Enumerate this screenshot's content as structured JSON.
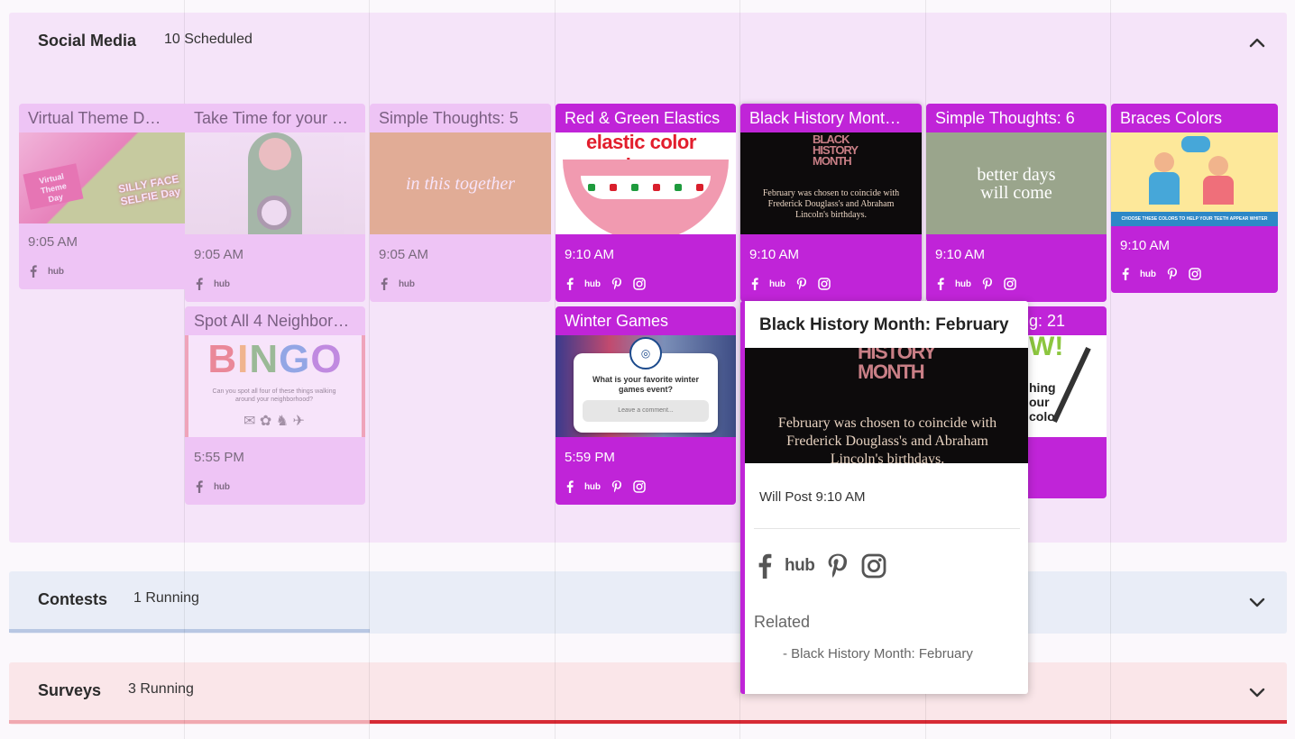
{
  "sections": {
    "social": {
      "title": "Social Media",
      "count": "10 Scheduled"
    },
    "contests": {
      "title": "Contests",
      "count": "1 Running"
    },
    "surveys": {
      "title": "Surveys",
      "count": "3 Running"
    }
  },
  "cards": [
    {
      "title": "Virtual Theme D…",
      "time": "9:05 AM",
      "image_text": "Virtual Theme Day · SILLY FACE SELFIE Day",
      "networks": [
        "facebook",
        "hub"
      ]
    },
    {
      "title": "Take Time for your …",
      "time": "9:05 AM",
      "image_text": "",
      "networks": [
        "facebook",
        "hub"
      ]
    },
    {
      "title": "Simple Thoughts: 5",
      "time": "9:05 AM",
      "image_text": "in this together",
      "networks": [
        "facebook",
        "hub"
      ]
    },
    {
      "title": "Red & Green Elastics",
      "time": "9:10 AM",
      "image_text": "elastic color combo:",
      "networks": [
        "facebook",
        "hub",
        "pinterest",
        "instagram"
      ]
    },
    {
      "title": "Black History Mont…",
      "time": "9:10 AM",
      "image_text": "BLACK HISTORY MONTH · February was chosen to coincide with Frederick Douglass's and Abraham Lincoln's birthdays.",
      "networks": [
        "facebook",
        "hub",
        "pinterest",
        "instagram"
      ]
    },
    {
      "title": "Simple Thoughts: 6",
      "time": "9:10 AM",
      "image_text": "better days will come",
      "networks": [
        "facebook",
        "hub",
        "pinterest",
        "instagram"
      ]
    },
    {
      "title": "Braces Colors",
      "time": "9:10 AM",
      "image_text": "CHOOSE THESE COLORS TO HELP YOUR TEETH APPEAR WHITER",
      "networks": [
        "facebook",
        "hub",
        "pinterest",
        "instagram"
      ]
    },
    {
      "title": "Spot All 4 Neighbor…",
      "time": "5:55 PM",
      "image_text": "BINGO · Can you spot all four of these things walking around your neighborhood?",
      "networks": [
        "facebook",
        "hub"
      ]
    },
    {
      "title": "Winter Games",
      "time": "5:59 PM",
      "image_text": "What is your favorite winter games event? · Leave a comment...",
      "networks": [
        "facebook",
        "hub",
        "pinterest",
        "instagram"
      ]
    },
    {
      "title": "g: 21",
      "time": "",
      "image_text": "W! · hing our color",
      "networks": []
    }
  ],
  "popover": {
    "title": "Black History Month: February",
    "image_heading": "HISTORY MONTH",
    "image_body": "February was chosen to coincide with Frederick Douglass's and Abraham Lincoln's birthdays.",
    "post_time": "Will Post 9:10 AM",
    "related_label": "Related",
    "related_item": "- Black History Month: February",
    "networks": [
      "facebook",
      "hub",
      "pinterest",
      "instagram"
    ]
  },
  "hub_label": "hub",
  "colors": {
    "accent": "#c024d8",
    "card_dim": "#eec4f5",
    "social_bg": "#f5e4f9",
    "contests_bg": "#e9edf7",
    "surveys_bg": "#fae6e9",
    "contests_bar": "#b8c7e3",
    "surveys_bar_light": "#f0a8b0",
    "surveys_bar": "#d62a35"
  }
}
